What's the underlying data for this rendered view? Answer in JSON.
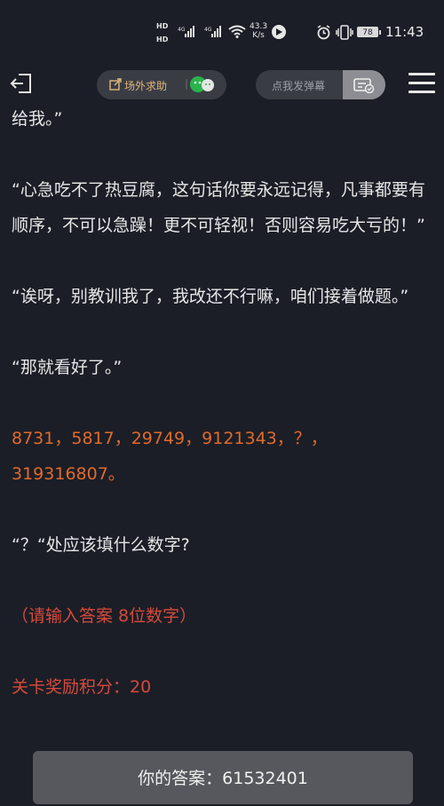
{
  "status_bar": {
    "hd1": "HD",
    "hd2": "HD",
    "net1": "4G",
    "net2": "4G",
    "speed_value": "43.3",
    "speed_unit": "K/s",
    "battery": "78",
    "time": "11:43"
  },
  "topbar": {
    "help_label": "场外求助",
    "danmu_placeholder": "点我发弹幕"
  },
  "content": {
    "p1": "给我。”",
    "p2": "“心急吃不了热豆腐，这句话你要永远记得，凡事都要有顺序，不可以急躁！更不可轻视！否则容易吃大亏的！”",
    "p3": "“诶呀，别教训我了，我改还不行嘛，咱们接着做题。”",
    "p4": "“那就看好了。”",
    "sequence": "8731，5817，29749，9121343，？，319316807。",
    "question": "“？“处应该填什么数字?",
    "hint": "（请输入答案 8位数字）",
    "reward": "关卡奖励积分：20"
  },
  "answer": {
    "text": "你的答案：61532401"
  },
  "colors": {
    "background": "#1b1e27",
    "sequence": "#e06a2a",
    "hint": "#d64a3a",
    "accent": "#e2b77a"
  },
  "icons": {
    "exit": "exit-icon",
    "help": "share-out-icon",
    "wechat": "wechat-icon",
    "danmu": "danmu-toggle-icon",
    "menu": "menu-icon"
  }
}
